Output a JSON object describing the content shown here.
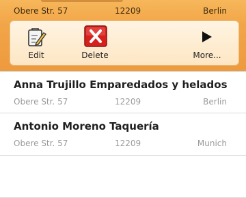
{
  "selected_item": {
    "address": "Obere Str. 57",
    "zip": "12209",
    "city": "Berlin"
  },
  "actions": [
    {
      "label": "Edit",
      "icon": "edit-icon"
    },
    {
      "label": "Delete",
      "icon": "delete-icon"
    },
    {
      "label": "More...",
      "icon": "play-arrow-icon"
    }
  ],
  "list": [
    {
      "title": "Anna Trujillo Emparedados y helados",
      "address": "Obere Str. 57",
      "zip": "12209",
      "city": "Berlin"
    },
    {
      "title": "Antonio Moreno Taquería",
      "address": "Obere Str. 57",
      "zip": "12209",
      "city": "Munich"
    },
    {
      "title": "",
      "address": "",
      "zip": "",
      "city": ""
    }
  ],
  "colors": {
    "selection_orange": "#f2a548",
    "action_bar_bg": "#fff4e2",
    "delete_red": "#d6201c",
    "title_text": "#202020",
    "subtitle_text": "#9a9a9a"
  }
}
